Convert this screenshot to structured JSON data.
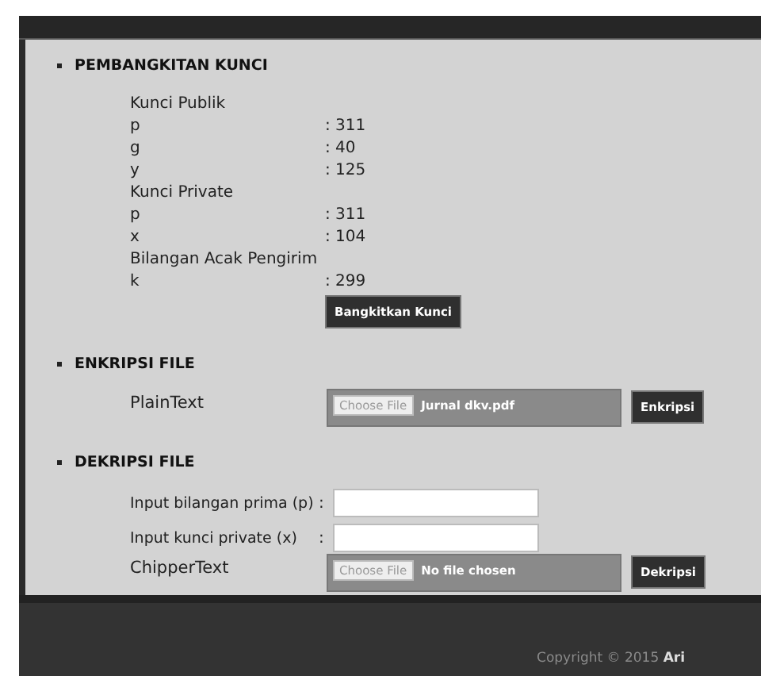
{
  "sections": [
    {
      "kind": "keys",
      "title": "PEMBANGKITAN KUNCI",
      "rows": [
        {
          "kind": "heading",
          "label": "Kunci Publik"
        },
        {
          "kind": "value",
          "label": "p",
          "value": ": 311"
        },
        {
          "kind": "value",
          "label": "g",
          "value": ": 40"
        },
        {
          "kind": "value",
          "label": "y",
          "value": ": 125"
        },
        {
          "kind": "heading",
          "label": "Kunci Private"
        },
        {
          "kind": "value",
          "label": "p",
          "value": ": 311"
        },
        {
          "kind": "value",
          "label": "x",
          "value": ": 104"
        },
        {
          "kind": "heading",
          "label": "Bilangan Acak Pengirim"
        },
        {
          "kind": "value",
          "label": "k",
          "value": ": 299"
        }
      ],
      "button": "Bangkitkan Kunci"
    },
    {
      "kind": "form",
      "title": "ENKRIPSI FILE",
      "rows": [
        {
          "kind": "file",
          "label": "PlainText",
          "choose": "Choose File",
          "file": "Jurnal dkv.pdf",
          "button": "Enkripsi"
        }
      ]
    },
    {
      "kind": "form",
      "title": "DEKRIPSI FILE",
      "rows": [
        {
          "kind": "input",
          "label": "Input bilangan prima (p)",
          "colon": ":"
        },
        {
          "kind": "input",
          "label": "Input kunci private (x)",
          "colon": ":"
        },
        {
          "kind": "file",
          "label": "ChipperText",
          "choose": "Choose File",
          "file": "No file chosen",
          "button": "Dekripsi"
        }
      ]
    }
  ],
  "footer": {
    "copyright": "Copyright © 2015 **Ari**"
  }
}
